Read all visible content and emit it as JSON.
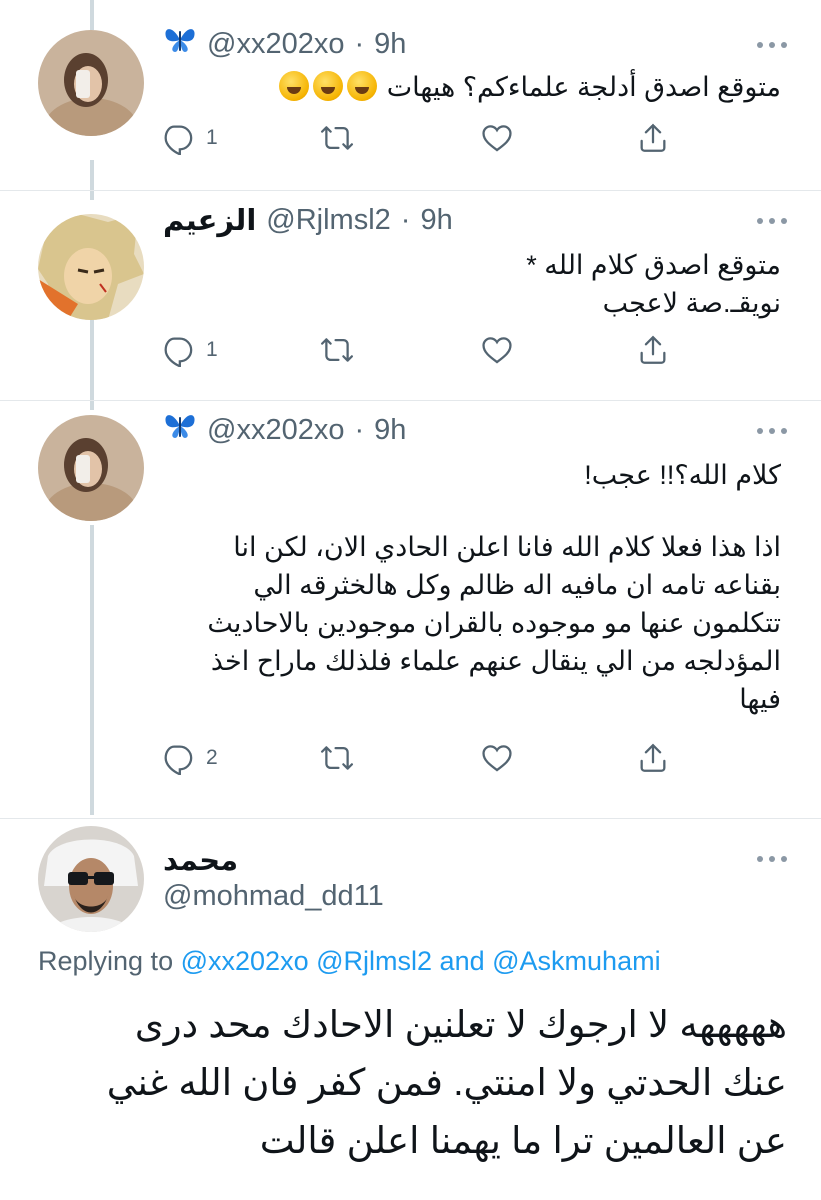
{
  "thread": [
    {
      "display_name": "",
      "badge_icon": "butterfly-icon",
      "handle": "@xx202xo",
      "separator": "·",
      "time": "9h",
      "text_lines": [
        "متوقع اصدق أدلجة علماءكم؟ هيهات"
      ],
      "emoji": [
        "rolling-on-floor-laughing-emoji",
        "rolling-on-floor-laughing-emoji",
        "rolling-on-floor-laughing-emoji"
      ],
      "reply_count": "1",
      "retweet_count": "",
      "like_count": ""
    },
    {
      "display_name": "الزعيم",
      "badge_icon": "",
      "handle": "@Rjlmsl2",
      "separator": "·",
      "time": "9h",
      "text_lines": [
        "متوقع اصدق كلام الله *",
        "نويقـ.صة لاعجب"
      ],
      "reply_count": "1",
      "retweet_count": "",
      "like_count": ""
    },
    {
      "display_name": "",
      "badge_icon": "butterfly-icon",
      "handle": "@xx202xo",
      "separator": "·",
      "time": "9h",
      "text_lines": [
        "كلام الله؟!! عجب!",
        "اذا هذا فعلا كلام الله فانا اعلن الحادي الان، لكن انا",
        "بقناعه تامه ان مافيه اله ظالم وكل هالخثرقه الي",
        "تتكلمون عنها مو موجوده بالقران موجودين بالاحاديث",
        "المؤدلجه من الي ينقال عنهم علماء فلذلك ماراح اخذ",
        "فيها"
      ],
      "reply_count": "2",
      "retweet_count": "",
      "like_count": ""
    }
  ],
  "main_tweet": {
    "display_name": "محمد",
    "handle": "@mohmad_dd11",
    "replying_prefix": "Replying to",
    "replying_mentions": [
      "@xx202xo",
      "@Rjlmsl2"
    ],
    "replying_and": "and",
    "replying_last": "@Askmuhami",
    "text_lines": [
      "هههههه لا ارجوك لا تعلنين الاحادك محد درى",
      "عنك  الحدتي ولا امنتي. فمن كفر فان الله غني",
      "عن العالمين ترا ما يهمنا  اعلن قالت"
    ]
  },
  "colors": {
    "text": "#0f1419",
    "secondary": "#536471",
    "link": "#1d9bf0",
    "thread_line": "#cfd9de",
    "divider": "#e4e8eb",
    "butterfly": "#1d6fd6"
  },
  "icons": {
    "reply": "reply-icon",
    "retweet": "retweet-icon",
    "like": "heart-icon",
    "share": "share-icon",
    "more": "more-icon"
  }
}
